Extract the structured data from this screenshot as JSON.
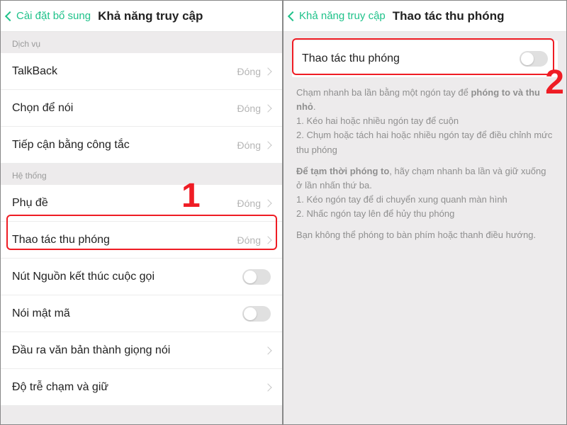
{
  "left": {
    "back": "Cài đặt bổ sung",
    "title": "Khả năng truy cập",
    "section_service": "Dịch vụ",
    "section_system": "Hệ thống",
    "closed": "Đóng",
    "rows": {
      "talkback": "TalkBack",
      "select_speak": "Chọn để nói",
      "switch_access": "Tiếp cận bằng công tắc",
      "captions": "Phụ đề",
      "zoom": "Thao tác thu phóng",
      "power_end_call": "Nút Nguồn kết thúc cuộc gọi",
      "speak_password": "Nói mật mã",
      "tts": "Đầu ra văn bản thành giọng nói",
      "touch_hold": "Độ trễ chạm và giữ"
    }
  },
  "right": {
    "back": "Khả năng truy cập",
    "title": "Thao tác thu phóng",
    "panel_label": "Thao tác thu phóng",
    "p1a": "Chạm nhanh ba lần bằng một ngón tay để ",
    "p1b": "phóng to và thu nhỏ",
    "p1c": ".",
    "p1l1": "1. Kéo hai hoặc nhiều ngón tay để cuộn",
    "p1l2": "2. Chụm hoặc tách hai hoặc nhiều ngón tay để điều chỉnh mức thu phóng",
    "p2a": "Để tạm thời phóng to",
    "p2b": ", hãy chạm nhanh ba lần và giữ xuống ở lần nhấn thứ ba.",
    "p2l1": "1. Kéo ngón tay để di chuyển xung quanh màn hình",
    "p2l2": "2. Nhấc ngón tay lên để hủy thu phóng",
    "p3": "Bạn không thể phóng to bàn phím hoặc thanh điều hướng."
  },
  "annot": {
    "one": "1",
    "two": "2"
  }
}
